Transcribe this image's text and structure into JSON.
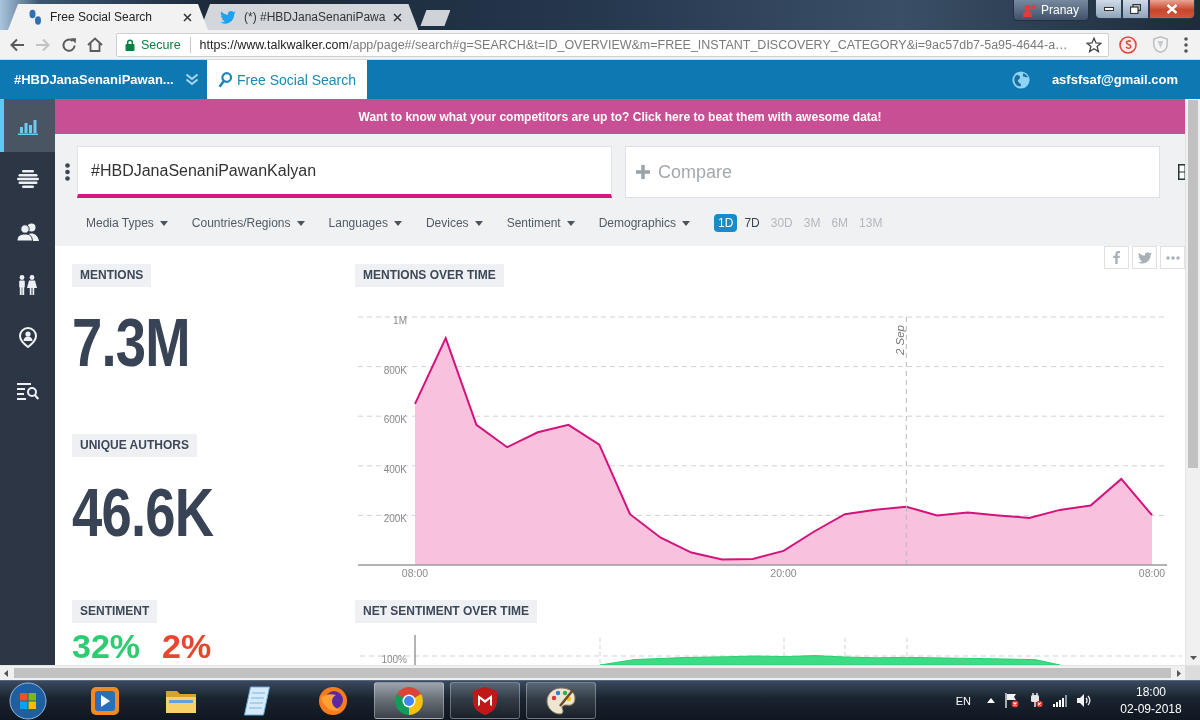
{
  "browser": {
    "tabs": [
      {
        "title": "Free Social Search",
        "kind": "footprint",
        "selected": true
      },
      {
        "title": "(*) #HBDJanaSenaniPawa",
        "kind": "bird",
        "selected": false
      }
    ],
    "profile": "Pranay",
    "nav": [
      {
        "kind": "back",
        "disabled": false
      },
      {
        "kind": "forward",
        "disabled": true
      },
      {
        "kind": "reload",
        "disabled": false
      },
      {
        "kind": "home",
        "disabled": false
      }
    ],
    "security": "Secure",
    "url": {
      "origin": "https://www.talkwalker.com",
      "path": "/app/page#/search#g=SEARCH&t=ID_OVERVIEW&m=FREE_INSTANT_DISCOVERY_CATEGORY&i=9ac57db7-5a95-4644-a…"
    }
  },
  "app_header": {
    "project": "#HBDJanaSenaniPawan...",
    "tab": "Free Social Search",
    "account": "asfsfsaf@gmail.com"
  },
  "sidebar": [
    {
      "kind": "chart",
      "selected": true
    },
    {
      "kind": "layers",
      "selected": false
    },
    {
      "kind": "profile",
      "selected": false
    },
    {
      "kind": "couple",
      "selected": false
    },
    {
      "kind": "location",
      "selected": false
    },
    {
      "kind": "listsearch",
      "selected": false
    }
  ],
  "banner": "Want to know what your competitors are up to? Click here to beat them with awesome data!",
  "search": {
    "query": "#HBDJanaSenaniPawanKalyan",
    "compare_placeholder": "Compare"
  },
  "filters": [
    "Media Types",
    "Countries/Regions",
    "Languages",
    "Devices",
    "Sentiment",
    "Demographics"
  ],
  "periods": [
    {
      "label": "1D",
      "selected": true,
      "disabled": false
    },
    {
      "label": "7D",
      "selected": false,
      "disabled": false
    },
    {
      "label": "30D",
      "selected": false,
      "disabled": true
    },
    {
      "label": "3M",
      "selected": false,
      "disabled": true
    },
    {
      "label": "6M",
      "selected": false,
      "disabled": true
    },
    {
      "label": "13M",
      "selected": false,
      "disabled": true
    }
  ],
  "share_buttons": [
    {
      "kind": "facebook"
    },
    {
      "kind": "twitter"
    },
    {
      "kind": "more"
    }
  ],
  "metrics": [
    {
      "label": "MENTIONS",
      "value": "7.3M"
    },
    {
      "label": "UNIQUE AUTHORS",
      "value": "46.6K"
    }
  ],
  "mentions_chart": {
    "chart_data": {
      "type": "area",
      "title": "MENTIONS OVER TIME",
      "categories": [
        "08:00",
        null,
        null,
        null,
        null,
        null,
        null,
        null,
        null,
        null,
        null,
        null,
        "20:00",
        null,
        null,
        null,
        null,
        null,
        null,
        null,
        null,
        null,
        null,
        null,
        "08:00"
      ],
      "values": [
        650000,
        915000,
        565000,
        475000,
        535000,
        565000,
        485000,
        205000,
        110000,
        50000,
        22000,
        24000,
        57000,
        135000,
        205000,
        223000,
        235000,
        200000,
        212000,
        200000,
        190000,
        222000,
        240000,
        347000,
        201000
      ],
      "ylim": [
        0,
        1000000
      ],
      "yticks": [
        {
          "value": 200000,
          "label": "200K"
        },
        {
          "value": 400000,
          "label": "400K"
        },
        {
          "value": 600000,
          "label": "600K"
        },
        {
          "value": 800000,
          "label": "800K"
        },
        {
          "value": 1000000,
          "label": "1M"
        }
      ],
      "grid": true,
      "annotations": [
        {
          "text": "2 Sep"
        }
      ]
    }
  },
  "sentiment": {
    "label": "SENTIMENT",
    "values": [
      {
        "text": "32%",
        "kind": "positive"
      },
      {
        "text": "2%",
        "kind": "negative"
      }
    ]
  },
  "net_sentiment": {
    "title": "NET SENTIMENT OVER TIME",
    "tick": "100%"
  },
  "taskbar": {
    "apps": [
      {
        "kind": "player",
        "open": false,
        "selected": false
      },
      {
        "kind": "folder",
        "open": false,
        "selected": false
      },
      {
        "kind": "notepad",
        "open": false,
        "selected": false
      },
      {
        "kind": "fox",
        "open": false,
        "selected": false
      },
      {
        "kind": "wheel",
        "open": true,
        "selected": true
      },
      {
        "kind": "shield",
        "open": true,
        "selected": false
      },
      {
        "kind": "palette",
        "open": true,
        "selected": false
      }
    ],
    "language": "EN",
    "time": "18:00",
    "date": "02-09-2018"
  }
}
